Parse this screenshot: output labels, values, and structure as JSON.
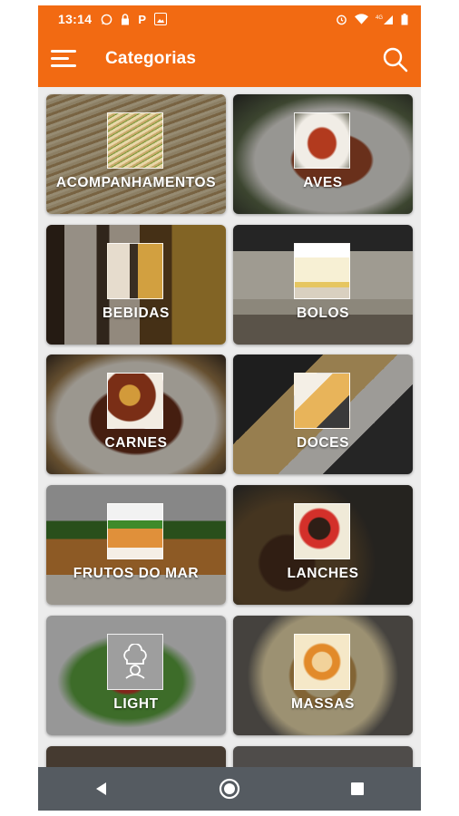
{
  "status_bar": {
    "time": "13:14",
    "left_icons": [
      "whatsapp-icon",
      "lock-icon",
      "p-icon",
      "image-icon"
    ],
    "p_glyph": "P",
    "signal_label": "4G",
    "right_icons": [
      "alarm-icon",
      "wifi-icon",
      "signal-icon",
      "battery-icon"
    ]
  },
  "app_bar": {
    "title": "Categorias",
    "menu_icon": "menu-icon",
    "search_icon": "search-icon",
    "background": "#f26a12"
  },
  "categories": [
    {
      "label": "ACOMPANHAMENTOS"
    },
    {
      "label": "AVES"
    },
    {
      "label": "BEBIDAS"
    },
    {
      "label": "BOLOS"
    },
    {
      "label": "CARNES"
    },
    {
      "label": "DOCES"
    },
    {
      "label": "FRUTOS DO MAR"
    },
    {
      "label": "LANCHES"
    },
    {
      "label": "LIGHT"
    },
    {
      "label": "MASSAS"
    }
  ],
  "nav_bar": {
    "icons": [
      "back-icon",
      "home-icon",
      "recents-icon"
    ]
  }
}
